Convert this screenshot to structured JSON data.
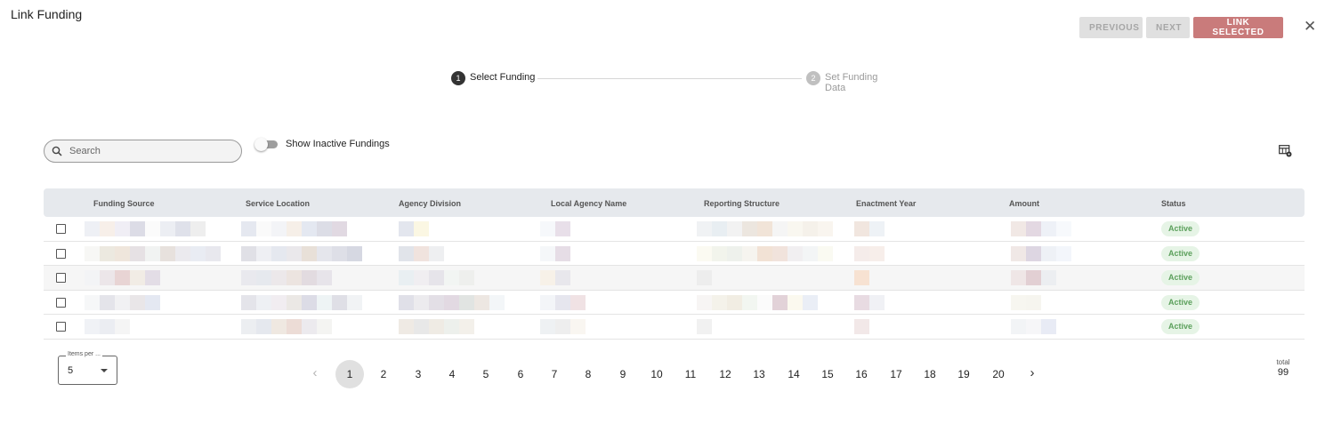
{
  "dialog": {
    "title": "Link Funding"
  },
  "actions": {
    "previous": "PREVIOUS",
    "next": "NEXT",
    "link_selected": "LINK SELECTED",
    "close_icon": "close-icon"
  },
  "stepper": {
    "steps": [
      {
        "number": "1",
        "label": "Select Funding",
        "active": true
      },
      {
        "number": "2",
        "label": "Set Funding Data",
        "active": false
      }
    ]
  },
  "filters": {
    "search_placeholder": "Search",
    "search_value": "",
    "toggle_label": "Show Inactive Fundings",
    "toggle_on": false
  },
  "table": {
    "columns": [
      "Funding Source",
      "Service Location",
      "Agency Division",
      "Local Agency Name",
      "Reporting Structure",
      "Enactment Year",
      "Amount",
      "Status"
    ],
    "rows": [
      {
        "status": "Active"
      },
      {
        "status": "Active"
      },
      {
        "status": "Active"
      },
      {
        "status": "Active"
      },
      {
        "status": "Active"
      }
    ]
  },
  "pagination": {
    "items_per_page_label": "Items per ...",
    "items_per_page": "5",
    "pages": [
      "1",
      "2",
      "3",
      "4",
      "5",
      "6",
      "7",
      "8",
      "9",
      "10",
      "11",
      "12",
      "13",
      "14",
      "15",
      "16",
      "17",
      "18",
      "19",
      "20"
    ],
    "current_page": "1",
    "total_label": "total",
    "total": "99"
  },
  "colors": {
    "link_button": "#c97b7b",
    "status_bg": "#e6f4e6",
    "status_text": "#5ca05c",
    "header_bg": "#e6e9ed"
  }
}
